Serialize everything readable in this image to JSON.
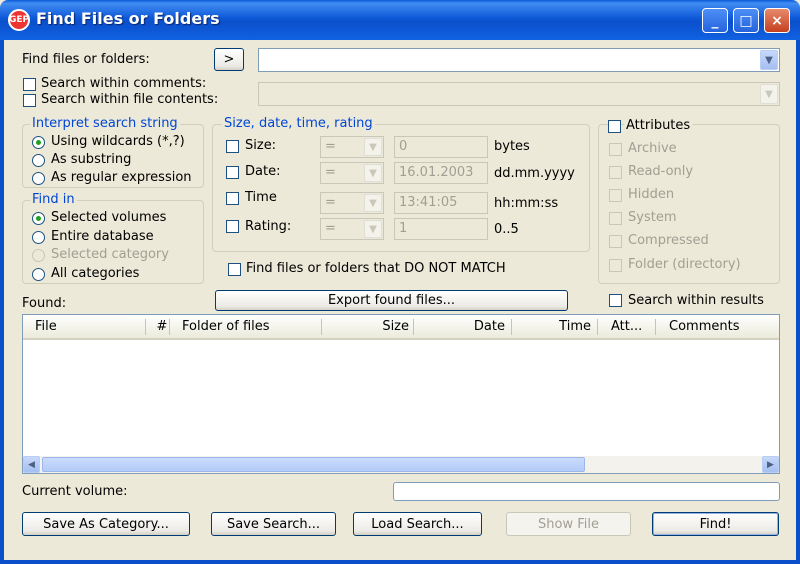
{
  "window": {
    "title": "Find Files or Folders",
    "app_icon_text": "GEP",
    "minimize": "_",
    "maximize": "□",
    "close": "×"
  },
  "search": {
    "label": "Find files or folders:",
    "arrow_button": ">",
    "value": "",
    "within_comments": "Search within comments:",
    "within_contents": "Search within file contents:"
  },
  "interpret": {
    "legend": "Interpret search string",
    "options": [
      "Using wildcards (*,?)",
      "As substring",
      "As regular expression"
    ],
    "selected": 0
  },
  "find_in": {
    "legend": "Find in",
    "options": [
      "Selected volumes",
      "Entire database",
      "Selected category",
      "All categories"
    ]
  },
  "sdtr": {
    "legend": "Size, date, time, rating",
    "rows": [
      {
        "label": "Size:",
        "op": "=",
        "value": "0",
        "unit": "bytes"
      },
      {
        "label": "Date:",
        "op": "=",
        "value": "16.01.2003",
        "unit": "dd.mm.yyyy"
      },
      {
        "label": "Time",
        "op": "=",
        "value": "13:41:05",
        "unit": "hh:mm:ss"
      },
      {
        "label": "Rating:",
        "op": "=",
        "value": "1",
        "unit": "0..5"
      }
    ],
    "not_match": "Find files or folders that DO NOT MATCH"
  },
  "attributes": {
    "legend": "Attributes",
    "items": [
      "Archive",
      "Read-only",
      "Hidden",
      "System",
      "Compressed",
      "Folder (directory)"
    ]
  },
  "found": {
    "label": "Found:",
    "export_button": "Export found files...",
    "search_within": "Search within results",
    "columns": [
      "File",
      "#",
      "Folder of files",
      "Size",
      "Date",
      "Time",
      "Att...",
      "Comments"
    ]
  },
  "current_volume": {
    "label": "Current volume:",
    "value": ""
  },
  "buttons": {
    "save_category": "Save As Category...",
    "save_search": "Save Search...",
    "load_search": "Load Search...",
    "show_file": "Show File",
    "find": "Find!"
  },
  "colors": {
    "titlebar": "#0b4fcb",
    "legend": "#0046d5",
    "face": "#ece9d8"
  }
}
